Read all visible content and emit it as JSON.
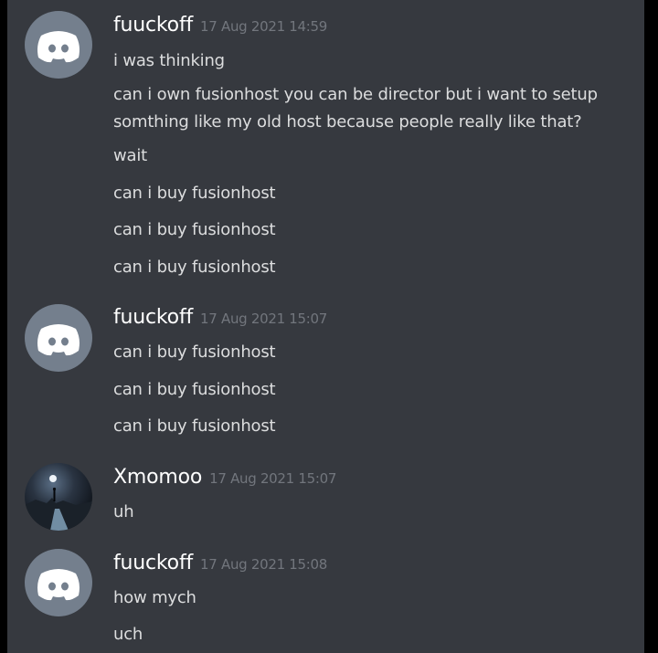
{
  "messages": [
    {
      "avatar": "discord-default-icon",
      "username": "fuuckoff",
      "timestamp": "17 Aug 2021 14:59",
      "lines": [
        "i was thinking",
        "can i own fusionhost you can be director but i want to setup",
        "somthing like my old host because people really like that?",
        "wait",
        "can i buy fusionhost",
        "can i buy fusionhost",
        "can i buy fusionhost"
      ]
    },
    {
      "avatar": "discord-default-icon",
      "username": "fuuckoff",
      "timestamp": "17 Aug 2021 15:07",
      "lines": [
        "can i buy fusionhost",
        "can i buy fusionhost",
        "can i buy fusionhost"
      ]
    },
    {
      "avatar": "night-landscape-photo",
      "username": "Xmomoo",
      "timestamp": "17 Aug 2021 15:07",
      "lines": [
        "uh"
      ]
    },
    {
      "avatar": "discord-default-icon",
      "username": "fuuckoff",
      "timestamp": "17 Aug 2021 15:08",
      "lines": [
        "how mych",
        "uch"
      ]
    }
  ],
  "colors": {
    "background": "#36393f",
    "username": "#ffffff",
    "message_text": "#dcddde",
    "timestamp": "#72767d",
    "default_avatar": "#747f8d"
  }
}
